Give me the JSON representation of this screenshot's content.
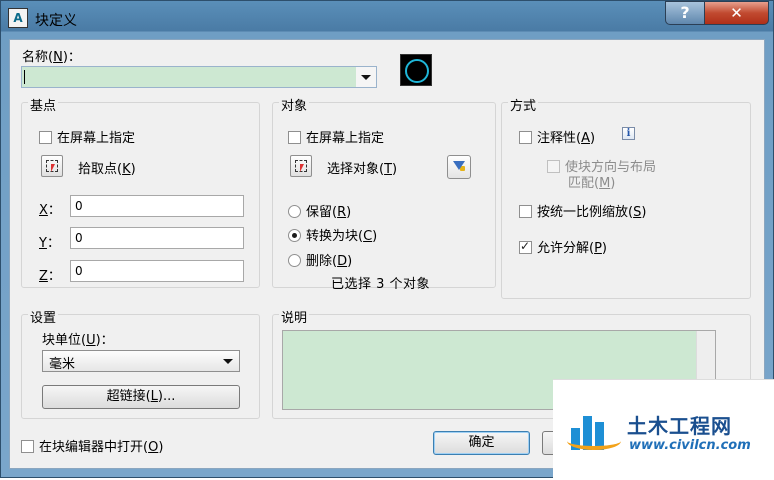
{
  "window": {
    "title": "块定义",
    "icon_name": "autocad-app-icon",
    "help_label": "?",
    "close_label": "✕"
  },
  "name": {
    "label_prefix": "名称(",
    "label_key": "N",
    "label_suffix": ")：",
    "value": ""
  },
  "base_point": {
    "title": "基点",
    "specify_on_screen": "在屏幕上指定",
    "specify_checked": false,
    "pick_prefix": "拾取点(",
    "pick_key": "K",
    "pick_suffix": ")",
    "x_key": "X",
    "x_suffix": "：",
    "x_value": "0",
    "y_key": "Y",
    "y_suffix": "：",
    "y_value": "0",
    "z_key": "Z",
    "z_suffix": "：",
    "z_value": "0"
  },
  "objects": {
    "title": "对象",
    "specify_on_screen": "在屏幕上指定",
    "specify_checked": false,
    "select_prefix": "选择对象(",
    "select_key": "T",
    "select_suffix": ")",
    "retain_prefix": "保留(",
    "retain_key": "R",
    "retain_suffix": ")",
    "convert_prefix": "转换为块(",
    "convert_key": "C",
    "convert_suffix": ")",
    "delete_prefix": "删除(",
    "delete_key": "D",
    "delete_suffix": ")",
    "selected_option": "convert",
    "selection_status": "已选择 3 个对象"
  },
  "behavior": {
    "title": "方式",
    "annotative_prefix": "注释性(",
    "annotative_key": "A",
    "annotative_suffix": ")",
    "annotative_checked": false,
    "info_label": "i",
    "match_line1": "使块方向与布局",
    "match_line2_prefix": "匹配(",
    "match_key": "M",
    "match_suffix": ")",
    "uniform_prefix": "按统一比例缩放(",
    "uniform_key": "S",
    "uniform_suffix": ")",
    "uniform_checked": false,
    "explode_prefix": "允许分解(",
    "explode_key": "P",
    "explode_suffix": ")",
    "explode_checked": true
  },
  "settings": {
    "title": "设置",
    "unit_prefix": "块单位(",
    "unit_key": "U",
    "unit_suffix": ")：",
    "unit_value": "毫米",
    "hyperlink_prefix": "超链接(",
    "hyperlink_key": "L",
    "hyperlink_suffix": ")..."
  },
  "description": {
    "title": "说明",
    "value": ""
  },
  "footer": {
    "open_editor_prefix": "在块编辑器中打开(",
    "open_editor_key": "O",
    "open_editor_suffix": ")",
    "open_editor_checked": false,
    "ok_label": "确定"
  },
  "watermark": {
    "title": "土木工程网",
    "url": "www.civilcn.com"
  },
  "colors": {
    "title_bar": "#4a7ba5",
    "close_button": "#c14a30",
    "input_fill": "#cde8d2",
    "dialog_bg": "#f0f0f0",
    "watermark_blue": "#1a4f8f",
    "watermark_orange": "#f2a21a"
  }
}
